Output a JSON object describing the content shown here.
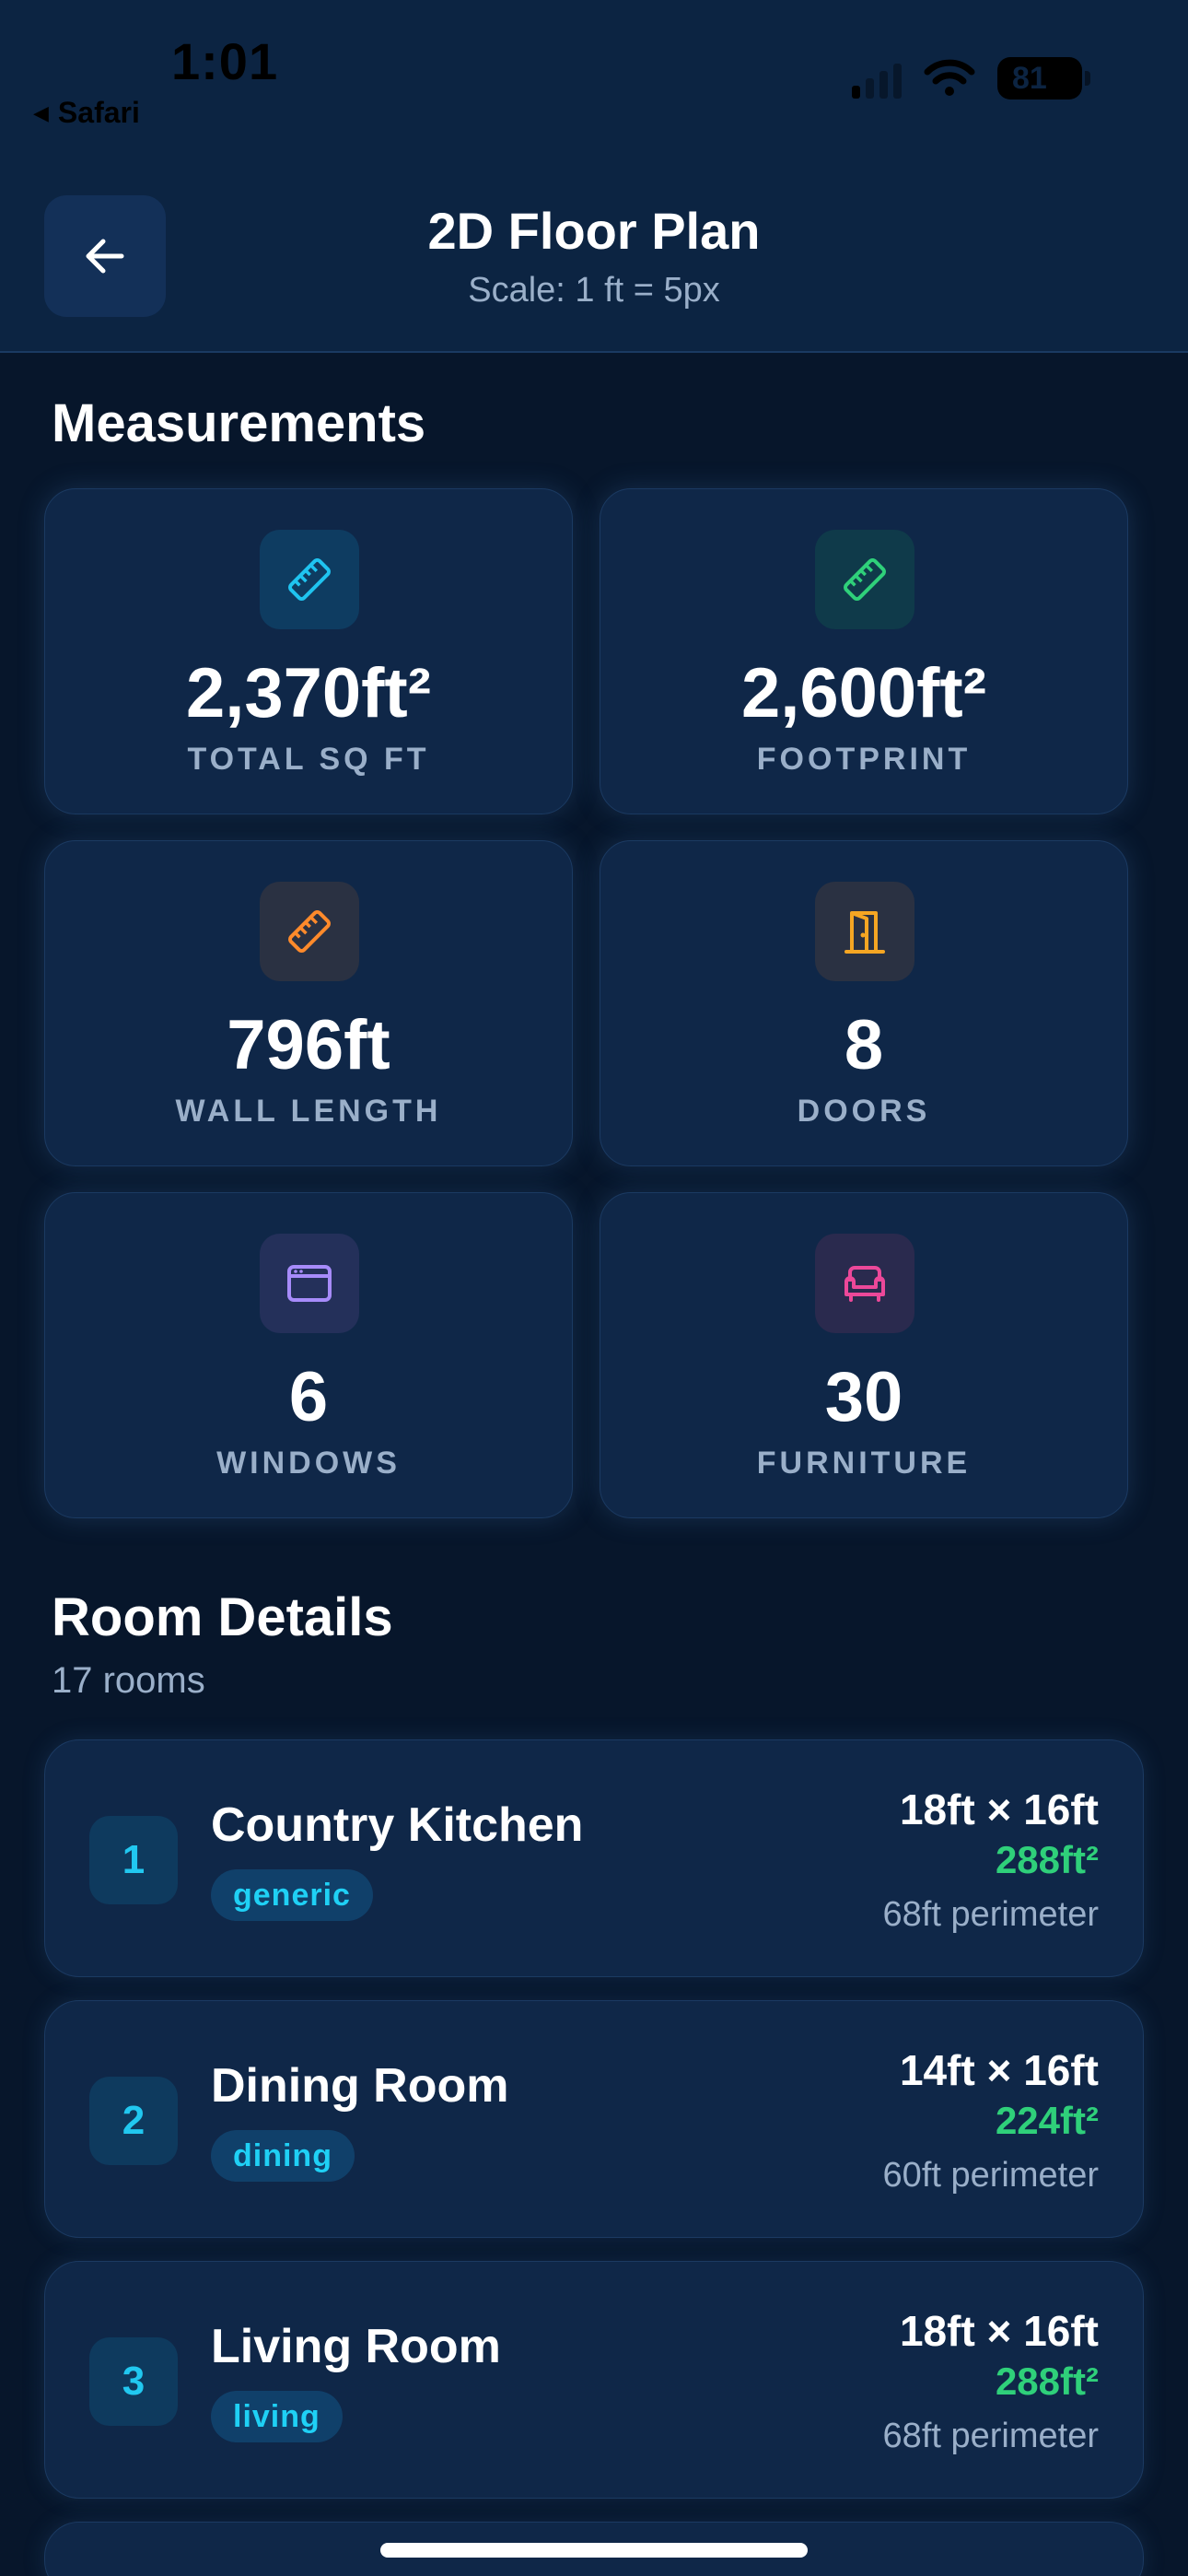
{
  "status_bar": {
    "time": "1:01",
    "back_app": "Safari",
    "battery": "81"
  },
  "header": {
    "title": "2D Floor Plan",
    "subtitle": "Scale: 1 ft = 5px"
  },
  "measurements": {
    "title": "Measurements",
    "cards": [
      {
        "value": "2,370ft²",
        "label": "TOTAL SQ FT",
        "icon": "ruler-icon",
        "color": "#1fc4f0",
        "bg": "#0e3c61"
      },
      {
        "value": "2,600ft²",
        "label": "FOOTPRINT",
        "icon": "ruler-icon",
        "color": "#2fd07a",
        "bg": "#0f3a4a"
      },
      {
        "value": "796ft",
        "label": "WALL LENGTH",
        "icon": "ruler-icon",
        "color": "#ff8a2b",
        "bg": "#2a3142"
      },
      {
        "value": "8",
        "label": "DOORS",
        "icon": "door-icon",
        "color": "#f5a623",
        "bg": "#2a3142"
      },
      {
        "value": "6",
        "label": "WINDOWS",
        "icon": "window-icon",
        "color": "#a78bfa",
        "bg": "#24305a"
      },
      {
        "value": "30",
        "label": "FURNITURE",
        "icon": "sofa-icon",
        "color": "#ec4899",
        "bg": "#2a2a4e"
      }
    ]
  },
  "rooms": {
    "title": "Room Details",
    "count": "17 rooms",
    "items": [
      {
        "num": "1",
        "name": "Country Kitchen",
        "tag": "generic",
        "dims": "18ft × 16ft",
        "area": "288ft²",
        "perimeter": "68ft perimeter"
      },
      {
        "num": "2",
        "name": "Dining Room",
        "tag": "dining",
        "dims": "14ft × 16ft",
        "area": "224ft²",
        "perimeter": "60ft perimeter"
      },
      {
        "num": "3",
        "name": "Living Room",
        "tag": "living",
        "dims": "18ft × 16ft",
        "area": "288ft²",
        "perimeter": "68ft perimeter"
      }
    ]
  },
  "colors": {
    "accent_cyan": "#1fc4f0",
    "accent_green": "#2fd07a",
    "background": "#07162b",
    "card": "#0f2748"
  }
}
